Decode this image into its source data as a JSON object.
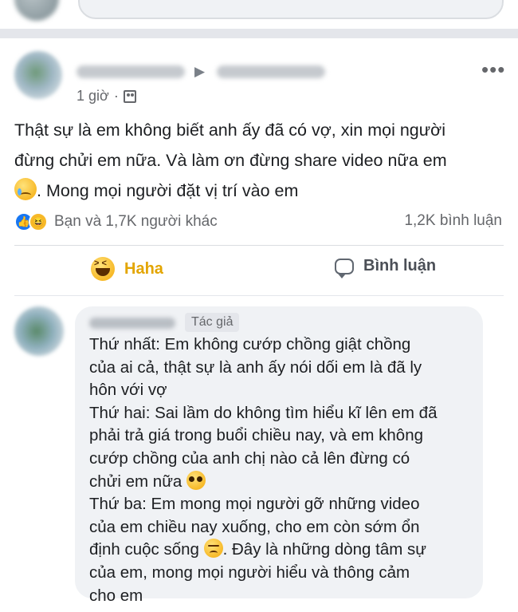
{
  "post": {
    "timestamp": "1 giờ",
    "separator": "·",
    "more_label": "•••",
    "author_arrow": "▶",
    "text_lines": [
      "Thật sự là em không biết anh ấy đã có vợ, xin mọi người",
      "đừng chửi em nữa. Và làm ơn đừng share video nữa em",
      ". Mong mọi người đặt vị trí vào em"
    ],
    "reactions_text": "Bạn và 1,7K người khác",
    "comments_count": "1,2K bình luận",
    "actions": {
      "haha_label": "Haha",
      "comment_label": "Bình luận"
    }
  },
  "comment": {
    "author_badge": "Tác giả",
    "lines": [
      "Thứ nhất: Em không cướp chồng giật chồng",
      "của ai cả, thật sự là anh ấy nói dối em là đã ly",
      "hôn với vợ",
      "Thứ hai: Sai lầm do không tìm hiểu kĩ lên em đã",
      "phải trả giá trong buổi chiều nay, và em không",
      "cướp chồng của anh chị nào cả lên đừng có",
      "chửi em nữa ",
      "Thứ ba: Em mong mọi người gỡ những video",
      "của em chiều nay xuống, cho em còn sớm ổn",
      "định cuộc sống ",
      ". Đây là những dòng tâm sự",
      "của em, mong mọi người hiểu và thông cảm",
      "cho em"
    ]
  },
  "colors": {
    "haha": "#e3a500",
    "like": "#1877f2",
    "bubble": "#f0f2f5"
  },
  "icons": [
    "group-icon",
    "more-icon",
    "like-reaction-icon",
    "haha-reaction-icon",
    "crying-emoji-icon",
    "haha-icon",
    "comment-icon",
    "pleading-emoji-icon",
    "disappointed-emoji-icon"
  ]
}
